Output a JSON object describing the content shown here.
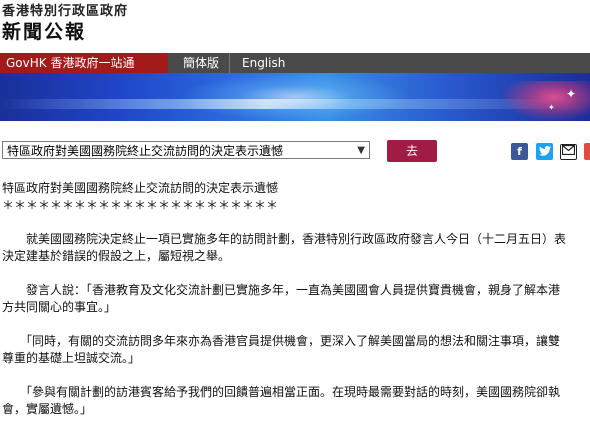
{
  "masthead": {
    "government": "香港特別行政區政府",
    "title": "新聞公報"
  },
  "nav": {
    "govhk": "GovHK 香港政府一站通",
    "simplified": "簡体版",
    "english": "English"
  },
  "toolbar": {
    "selected_title": "特區政府對美國國務院終止交流訪問的決定表示遺憾",
    "go_label": "去",
    "share_icons": [
      "facebook-icon",
      "twitter-icon",
      "mail-icon",
      "weibo-icon"
    ]
  },
  "article": {
    "title": "特區政府對美國國務院終止交流訪問的決定表示遺憾",
    "stars": "＊＊＊＊＊＊＊＊＊＊＊＊＊＊＊＊＊＊＊＊＊＊＊",
    "p1_line1": "　　就美國國務院決定終止一項已實施多年的訪問計劃，香港特別行政區政府發言人今日（十二月五日）表",
    "p1_line2": "決定建基於錯誤的假設之上，屬短視之舉。",
    "p2_line1": "　　發言人說：「香港教育及文化交流計劃已實施多年，一直為美國國會人員提供寶貴機會，親身了解本港",
    "p2_line2": "方共同關心的事宜。」",
    "p3_line1": "　　「同時，有關的交流訪問多年來亦為香港官員提供機會，更深入了解美國當局的想法和關注事項，讓雙",
    "p3_line2": "尊重的基礎上坦誠交流。」",
    "p4_line1": "　　「參與有關計劃的訪港賓客給予我們的回饋普遍相當正面。在現時最需要對話的時刻，美國國務院卻執",
    "p4_line2": "會，實屬遺憾。」"
  },
  "colors": {
    "nav_bg": "#4a4a4a",
    "govhk_bg": "#a31a1a",
    "go_button": "#a01c44",
    "banner_main": "#1f45c8"
  }
}
